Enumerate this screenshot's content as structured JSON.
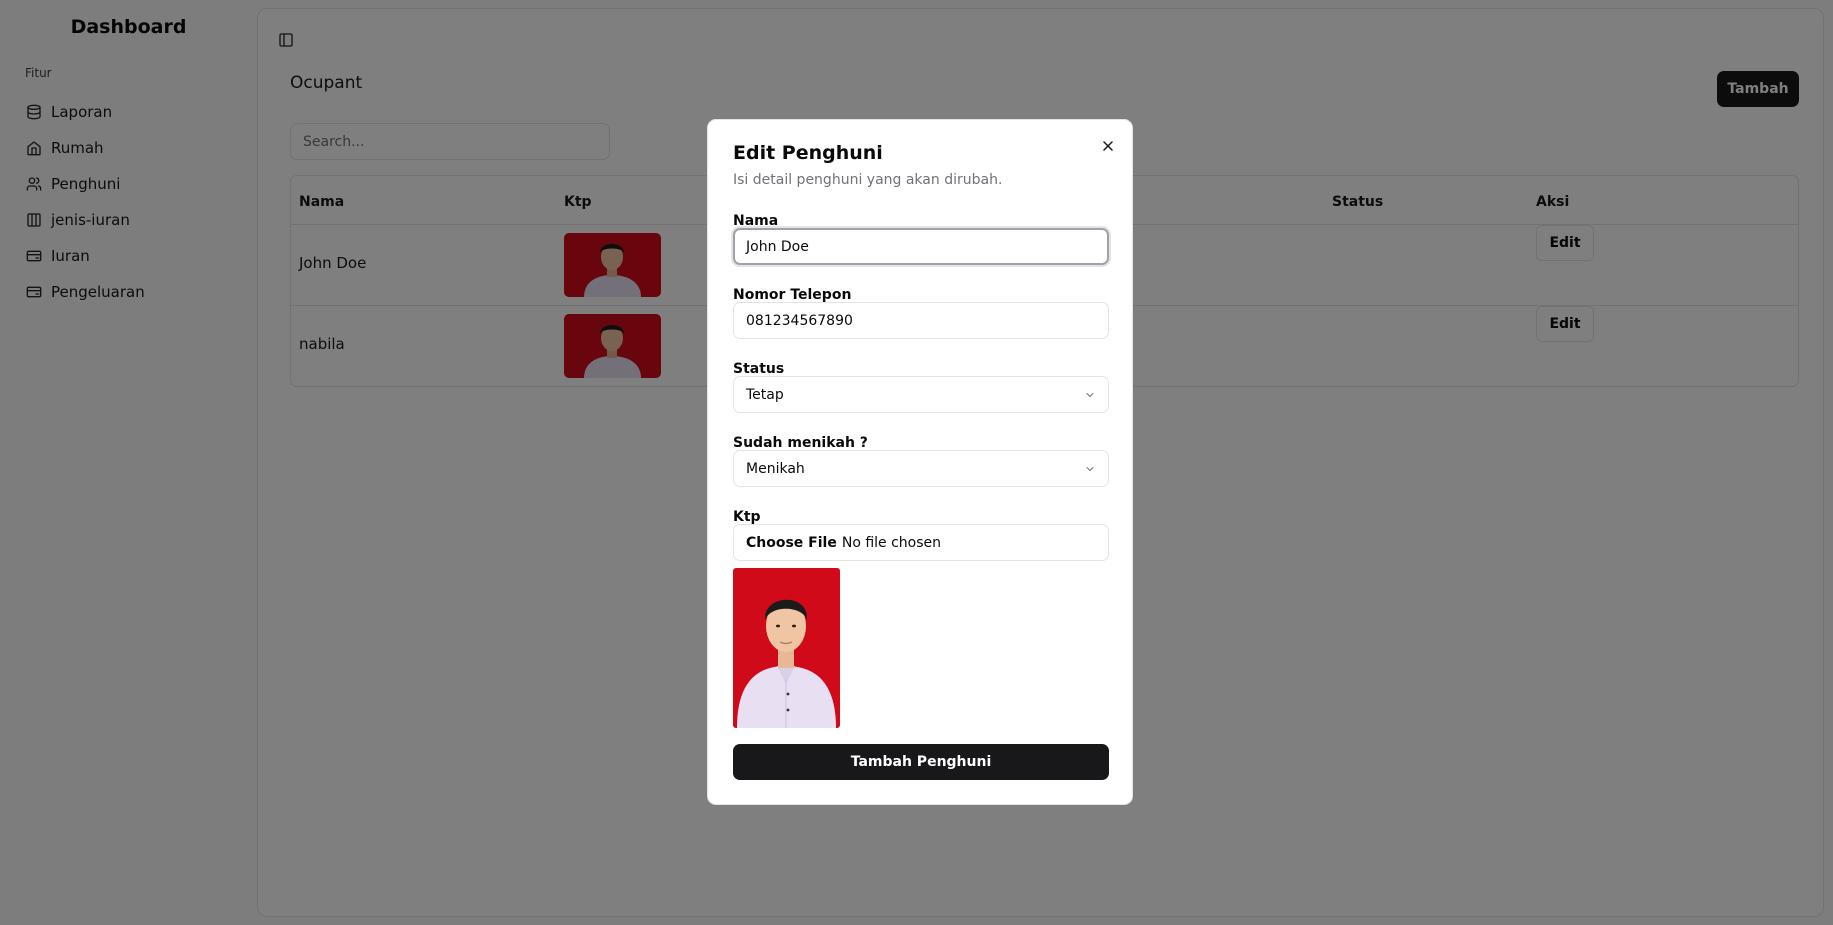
{
  "sidebar": {
    "title": "Dashboard",
    "group_label": "Fitur",
    "items": [
      {
        "label": "Laporan",
        "icon": "database-icon"
      },
      {
        "label": "Rumah",
        "icon": "home-icon"
      },
      {
        "label": "Penghuni",
        "icon": "users-icon"
      },
      {
        "label": "jenis-iuran",
        "icon": "table-columns-icon"
      },
      {
        "label": "Iuran",
        "icon": "card-icon"
      },
      {
        "label": "Pengeluaran",
        "icon": "card-icon"
      }
    ]
  },
  "main": {
    "title": "Ocupant",
    "add_button": "Tambah",
    "search_placeholder": "Search...",
    "table": {
      "headers": [
        "Nama",
        "Ktp",
        "Status",
        "Aksi"
      ],
      "rows": [
        {
          "nama": "John Doe",
          "status": "",
          "action": "Edit"
        },
        {
          "nama": "nabila",
          "status": "",
          "action": "Edit"
        }
      ]
    }
  },
  "modal": {
    "title": "Edit Penghuni",
    "description": "Isi detail penghuni yang akan dirubah.",
    "fields": {
      "nama": {
        "label": "Nama",
        "value": "John Doe"
      },
      "telepon": {
        "label": "Nomor Telepon",
        "value": "081234567890"
      },
      "status": {
        "label": "Status",
        "value": "Tetap"
      },
      "menikah": {
        "label": "Sudah menikah ?",
        "value": "Menikah"
      },
      "ktp": {
        "label": "Ktp",
        "button": "Choose File",
        "status_text": "No file chosen"
      }
    },
    "submit": "Tambah Penghuni"
  },
  "colors": {
    "primary": "#18181b",
    "photo_background": "#d10a1a",
    "shirt": "#e8e0f2"
  }
}
